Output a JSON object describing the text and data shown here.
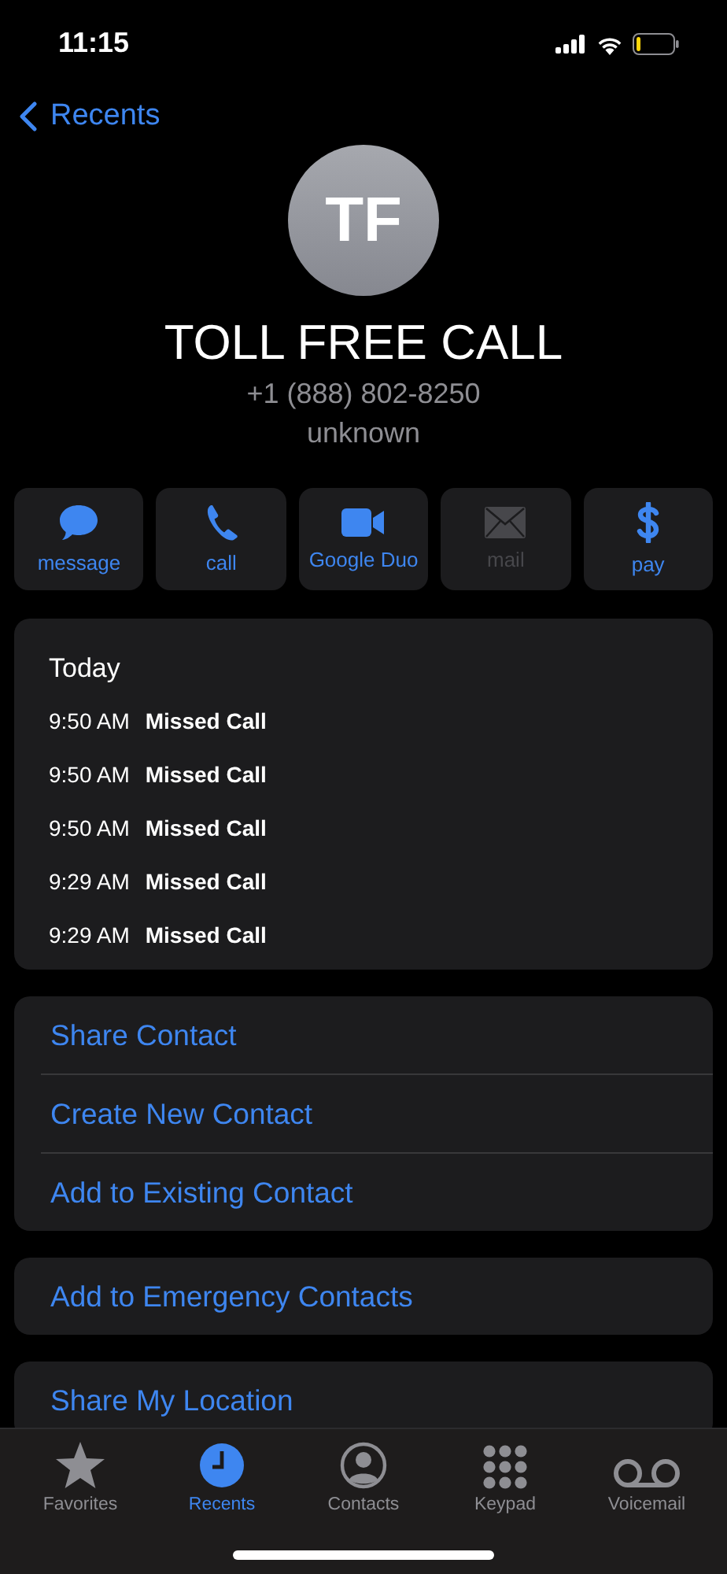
{
  "status_bar": {
    "time": "11:15"
  },
  "nav": {
    "back_label": "Recents"
  },
  "contact": {
    "initials": "TF",
    "name": "TOLL FREE CALL",
    "phone": "+1 (888) 802-8250",
    "label": "unknown"
  },
  "actions": [
    {
      "kind": "message",
      "label": "message",
      "disabled": false
    },
    {
      "kind": "call",
      "label": "call",
      "disabled": false
    },
    {
      "kind": "video",
      "label": "Google Duo",
      "disabled": false
    },
    {
      "kind": "mail",
      "label": "mail",
      "disabled": true
    },
    {
      "kind": "pay",
      "label": "pay",
      "disabled": false
    }
  ],
  "history": {
    "heading": "Today",
    "entries": [
      {
        "time": "9:50 AM",
        "type": "Missed Call"
      },
      {
        "time": "9:50 AM",
        "type": "Missed Call"
      },
      {
        "time": "9:50 AM",
        "type": "Missed Call"
      },
      {
        "time": "9:29 AM",
        "type": "Missed Call"
      },
      {
        "time": "9:29 AM",
        "type": "Missed Call"
      }
    ]
  },
  "option_groups": [
    [
      "Share Contact",
      "Create New Contact",
      "Add to Existing Contact"
    ],
    [
      "Add to Emergency Contacts"
    ],
    [
      "Share My Location"
    ]
  ],
  "tab_bar": [
    {
      "kind": "favorites",
      "label": "Favorites",
      "selected": false
    },
    {
      "kind": "recents",
      "label": "Recents",
      "selected": true
    },
    {
      "kind": "contacts",
      "label": "Contacts",
      "selected": false
    },
    {
      "kind": "keypad",
      "label": "Keypad",
      "selected": false
    },
    {
      "kind": "voicemail",
      "label": "Voicemail",
      "selected": false
    }
  ]
}
